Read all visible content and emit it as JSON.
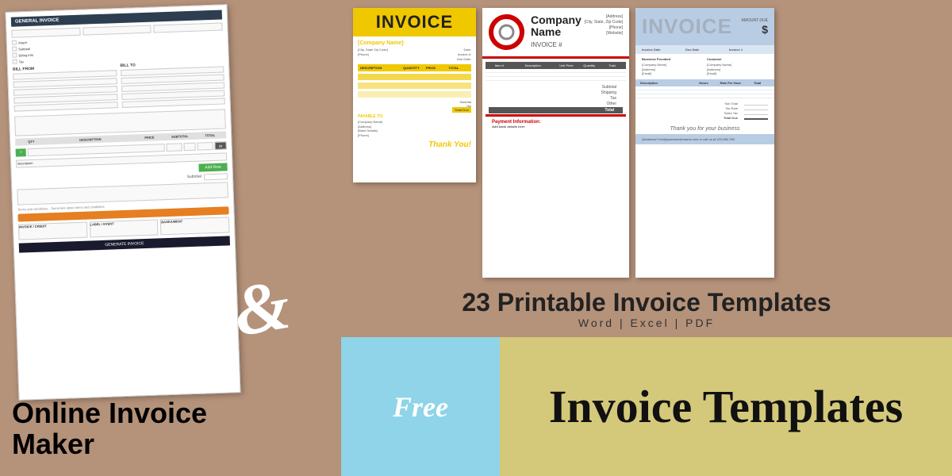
{
  "page": {
    "title": "Online Invoice Maker & Invoice Templates"
  },
  "left": {
    "ampersand": "&",
    "online_invoice_maker_line1": "Online Invoice",
    "online_invoice_maker_line2": "Maker"
  },
  "template1": {
    "title": "INVOICE",
    "company_name": "[Company Name]",
    "date_label": "Date:",
    "invoice_label": "Invoice #:",
    "due_label": "Due Date:",
    "desc_col": "DESCRIPTION",
    "qty_col": "QUANTITY",
    "price_col": "PRICE",
    "total_col": "TOTAL",
    "subtotal_label": "Subtotal",
    "tax_label": "Tax",
    "total_due_label": "Total Due",
    "payable_to": "PAYABLE TO:",
    "company_placeholder": "[Company Name]",
    "address_placeholder": "[Address]",
    "bank_placeholder": "[Bank Details]",
    "phone_placeholder": "[Phone]",
    "thank_you": "Thank You!"
  },
  "template2": {
    "company_name": "Company Name",
    "invoice_hash": "INVOICE #",
    "contact_info": "[Address]\n[City, State, Zip Code]\n[Phone]\n[Website]",
    "col_item": "Item #",
    "col_desc": "Description",
    "col_unit": "Unit Price",
    "col_qty": "Quantity",
    "col_total": "Total",
    "subtotal_label": "Subtotal",
    "shipping_label": "Shipping",
    "tax_label": "Tax",
    "other_label": "Other",
    "total_label": "Total",
    "payment_label": "Payment Information:",
    "payment_text": "Add bank details here"
  },
  "template3": {
    "title": "INVOICE",
    "amount_label": "$",
    "col_desc": "Description",
    "col_hours": "Hours",
    "col_rate": "Rate Per Hour",
    "col_total": "Total",
    "subtotal_label": "Sub Total",
    "tax_label": "Tax Rate",
    "total_label": "Sales Tax",
    "total_label2": "Total Due",
    "thank_you": "Thank you for your business",
    "billed_from_label": "[Company Name]",
    "billed_to_label": "[Company Name]",
    "footer_text": "Questions? info@yourdomainname.com or call us at 123-456-789"
  },
  "bottom": {
    "printable_title": "23 Printable Invoice Templates",
    "printable_subtitle": "Word  |  Excel  |  PDF",
    "free_text": "Free",
    "invoice_templates_text": "Invoice Templates"
  }
}
